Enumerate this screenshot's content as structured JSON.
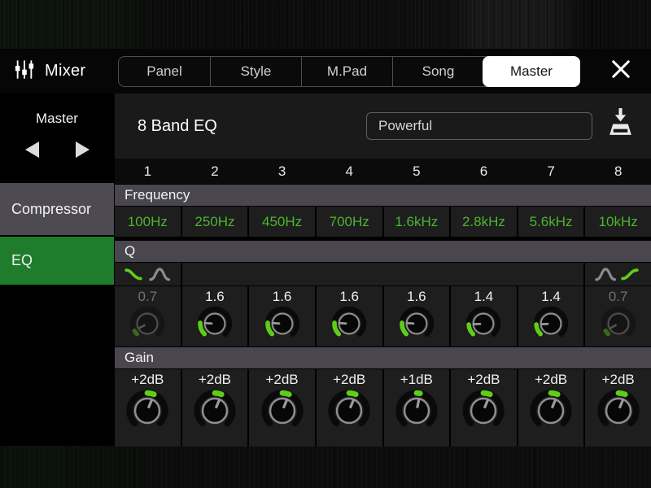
{
  "colors": {
    "accent_green_text": "#4db52f",
    "knob_green": "#5ecd17",
    "eq_active_bg": "#1e7c2c",
    "header_bar_bg": "#4a4650"
  },
  "titlebar": {
    "app_title": "Mixer",
    "tabs": [
      "Panel",
      "Style",
      "M.Pad",
      "Song",
      "Master"
    ],
    "active_tab": "Master"
  },
  "sidebar": {
    "channel": "Master",
    "items": [
      {
        "label": "Compressor",
        "active": false
      },
      {
        "label": "EQ",
        "active": true
      }
    ]
  },
  "eq": {
    "title": "8 Band EQ",
    "preset": "Powerful",
    "row_labels": {
      "frequency": "Frequency",
      "q": "Q",
      "gain": "Gain"
    },
    "bands": [
      {
        "number": "1",
        "frequency": "100Hz",
        "q": "0.7",
        "q_pos": 0.06,
        "q_dimmed": true,
        "gain": "+2dB",
        "gain_pos": 0.583,
        "filter_icons": [
          "shelf-low",
          "peak"
        ],
        "filter_selected": "shelf-low"
      },
      {
        "number": "2",
        "frequency": "250Hz",
        "q": "1.6",
        "q_pos": 0.18,
        "q_dimmed": false,
        "gain": "+2dB",
        "gain_pos": 0.583
      },
      {
        "number": "3",
        "frequency": "450Hz",
        "q": "1.6",
        "q_pos": 0.18,
        "q_dimmed": false,
        "gain": "+2dB",
        "gain_pos": 0.583
      },
      {
        "number": "4",
        "frequency": "700Hz",
        "q": "1.6",
        "q_pos": 0.18,
        "q_dimmed": false,
        "gain": "+2dB",
        "gain_pos": 0.583
      },
      {
        "number": "5",
        "frequency": "1.6kHz",
        "q": "1.6",
        "q_pos": 0.18,
        "q_dimmed": false,
        "gain": "+1dB",
        "gain_pos": 0.542
      },
      {
        "number": "6",
        "frequency": "2.8kHz",
        "q": "1.4",
        "q_pos": 0.155,
        "q_dimmed": false,
        "gain": "+2dB",
        "gain_pos": 0.583
      },
      {
        "number": "7",
        "frequency": "5.6kHz",
        "q": "1.4",
        "q_pos": 0.155,
        "q_dimmed": false,
        "gain": "+2dB",
        "gain_pos": 0.583
      },
      {
        "number": "8",
        "frequency": "10kHz",
        "q": "0.7",
        "q_pos": 0.06,
        "q_dimmed": true,
        "gain": "+2dB",
        "gain_pos": 0.583,
        "filter_icons": [
          "peak",
          "shelf-high"
        ],
        "filter_selected": "shelf-high"
      }
    ]
  }
}
